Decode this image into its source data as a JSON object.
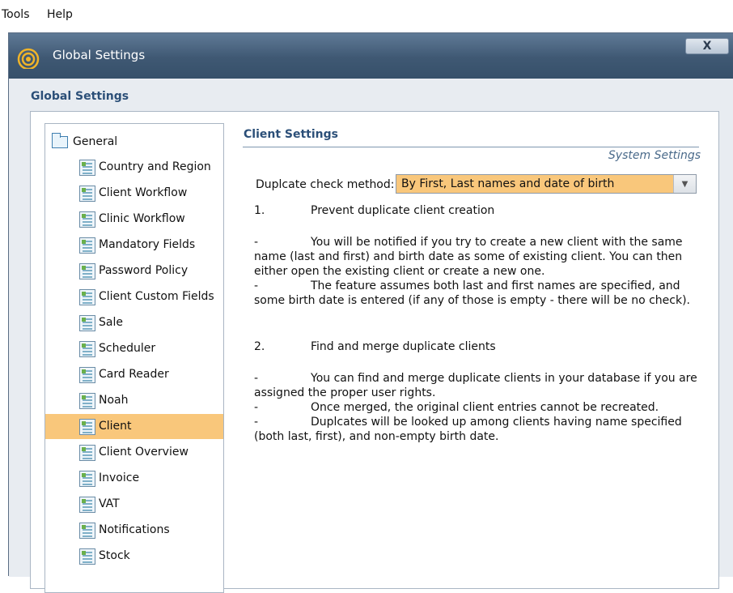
{
  "menubar": {
    "tools": "Tools",
    "help": "Help"
  },
  "window": {
    "title": "Global Settings",
    "close_label": "X"
  },
  "section_title": "Global Settings",
  "tree": {
    "root": "General",
    "items": [
      "Country and Region",
      "Client Workflow",
      "Clinic Workflow",
      "Mandatory Fields",
      "Password Policy",
      "Client Custom Fields",
      "Sale",
      "Scheduler",
      "Card Reader",
      "Noah",
      "Client",
      "Client Overview",
      "Invoice",
      "VAT",
      "Notifications",
      "Stock"
    ],
    "selected": "Client"
  },
  "client_settings": {
    "title": "Client Settings",
    "system_link": "System Settings",
    "dup_label": "Duplcate check method:",
    "dup_value": "By First, Last names and date of birth",
    "section1": {
      "num": "1.",
      "title": "Prevent duplicate client creation",
      "b1_first": "You will be notified if you try to create a new client with the same",
      "b1_rest": "name (last and first) and birth date as some of existing client. You can then either open the existing client or create a new one.",
      "b2_first": "The feature assumes both last and first names are specified, and",
      "b2_rest": "some birth date is entered (if any of those is empty - there will be no check)."
    },
    "section2": {
      "num": "2.",
      "title": "Find and merge duplicate clients",
      "b1_first": "You can find and merge duplicate clients in your database if you are",
      "b1_rest": "assigned the proper user rights.",
      "b2_first": "Once merged, the original client entries cannot be recreated.",
      "b3_first": "Duplcates will be looked up among clients having name specified",
      "b3_rest": "(both last, first), and non-empty birth date."
    },
    "dash": "-"
  },
  "colors": {
    "selection": "#f9c77b",
    "titlebar": "#3f5873",
    "heading": "#2b4f78"
  }
}
